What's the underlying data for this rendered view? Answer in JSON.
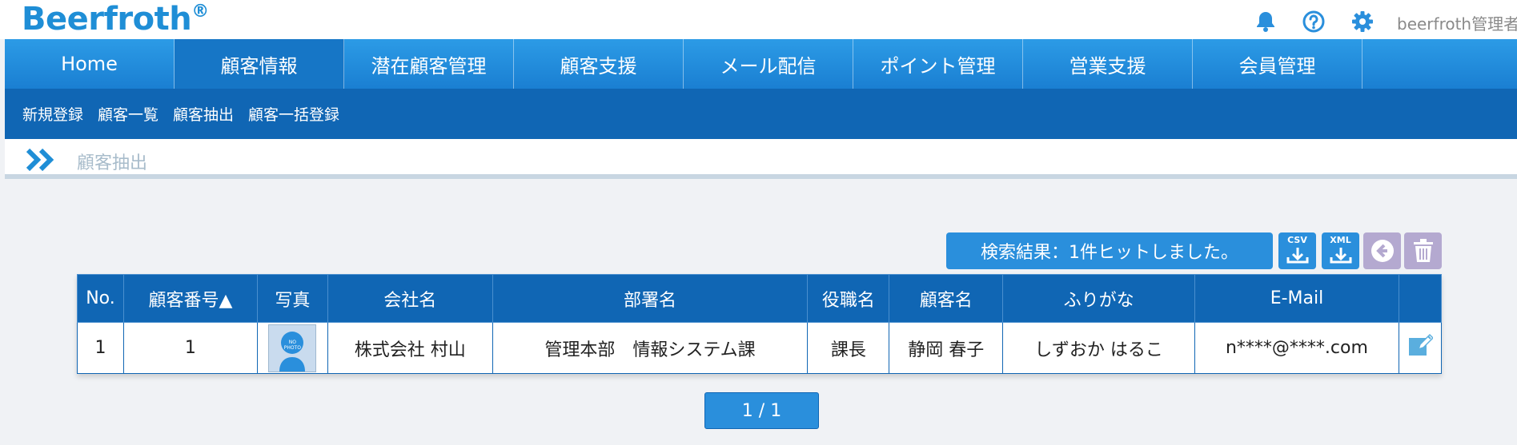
{
  "app": {
    "logo": "Beerfroth",
    "logo_mark": "®",
    "user_name": "beerfroth管理者"
  },
  "top_icons": [
    "bell-icon",
    "help-icon",
    "gear-icon"
  ],
  "nav": {
    "items": [
      {
        "label": "Home",
        "active": false
      },
      {
        "label": "顧客情報",
        "active": true
      },
      {
        "label": "潜在顧客管理",
        "active": false
      },
      {
        "label": "顧客支援",
        "active": false
      },
      {
        "label": "メール配信",
        "active": false
      },
      {
        "label": "ポイント管理",
        "active": false
      },
      {
        "label": "営業支援",
        "active": false
      },
      {
        "label": "会員管理",
        "active": false
      }
    ]
  },
  "subnav": {
    "items": [
      "新規登録",
      "顧客一覧",
      "顧客抽出",
      "顧客一括登録"
    ]
  },
  "breadcrumb": {
    "current": "顧客抽出"
  },
  "search": {
    "result_text": "検索結果：1件ヒットしました。",
    "csv_label": "CSV",
    "xml_label": "XML"
  },
  "table": {
    "headers": [
      "No.",
      "顧客番号▲",
      "写真",
      "会社名",
      "部署名",
      "役職名",
      "顧客名",
      "ふりがな",
      "E-Mail",
      ""
    ],
    "rows": [
      {
        "no": "1",
        "customer_number": "1",
        "photo_text": "NO PHOTO",
        "company": "株式会社 村山",
        "department": "管理本部　情報システム課",
        "title": "課長",
        "name": "静岡 春子",
        "furigana": "しずおか はるこ",
        "email": "n****@****.com"
      }
    ]
  },
  "pagination": {
    "label": "1 / 1"
  },
  "colors": {
    "brand": "#1f8ed6",
    "nav": "#1a7fd2",
    "subnav": "#1066b4",
    "button": "#2a8fdc",
    "disabled_button": "#b4a9d0"
  }
}
